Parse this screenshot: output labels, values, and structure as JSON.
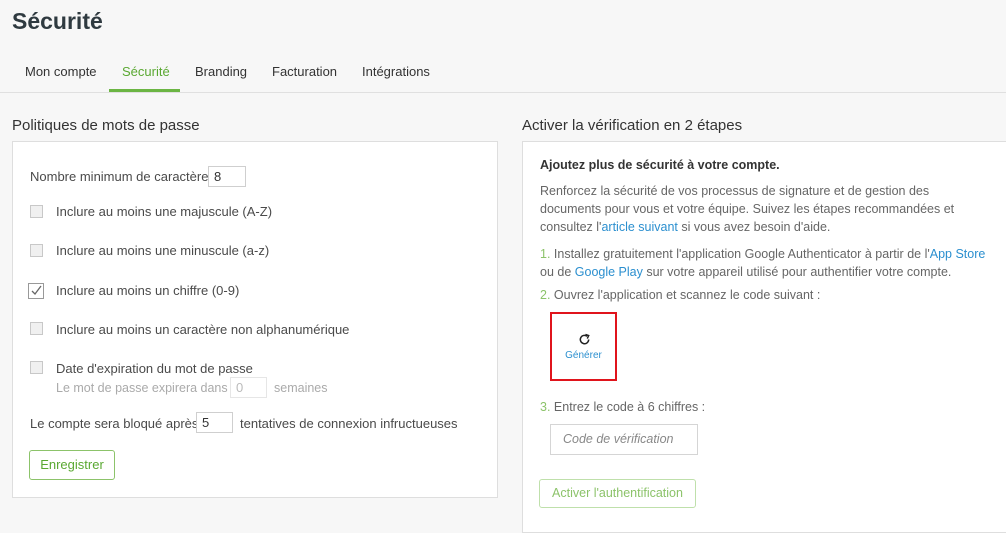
{
  "page": {
    "title": "Sécurité"
  },
  "tabs": [
    {
      "label": "Mon compte"
    },
    {
      "label": "Sécurité"
    },
    {
      "label": "Branding"
    },
    {
      "label": "Facturation"
    },
    {
      "label": "Intégrations"
    }
  ],
  "active_tab": 1,
  "password_policy": {
    "title": "Politiques de mots de passe",
    "min_chars_label": "Nombre minimum de caractères",
    "min_chars_value": "8",
    "options": [
      {
        "label": "Inclure au moins une majuscule (A-Z)",
        "checked": false
      },
      {
        "label": "Inclure au moins une minuscule (a-z)",
        "checked": false
      },
      {
        "label": "Inclure au moins un chiffre (0-9)",
        "checked": true
      },
      {
        "label": "Inclure au moins un caractère non alphanumérique",
        "checked": false
      },
      {
        "label": "Date d'expiration du mot de passe",
        "checked": false
      }
    ],
    "expiry_label": "Le mot de passe expirera dans :",
    "expiry_value": "0",
    "expiry_unit": "semaines",
    "lockout_label": "Le compte sera bloqué après :",
    "lockout_value": "5",
    "lockout_suffix": "tentatives de connexion infructueuses",
    "save_button": "Enregistrer"
  },
  "two_factor": {
    "title": "Activer la vérification en 2 étapes",
    "heading": "Ajoutez plus de sécurité à votre compte.",
    "intro_text": "Renforcez la sécurité de vos processus de signature et de gestion des documents pour vous et votre équipe. Suivez les étapes recommandées et consultez l'",
    "intro_link": "article suivant",
    "intro_tail": " si vous avez besoin d'aide.",
    "step1_num": "1.",
    "step1_text": " Installez gratuitement l'application Google Authenticator à partir de l'",
    "step1_link1": "App Store",
    "step1_mid": " ou de ",
    "step1_link2": "Google Play",
    "step1_tail": " sur votre appareil utilisé pour authentifier votre compte.",
    "step2_num": "2.",
    "step2_text": " Ouvrez l'application et scannez le code suivant :",
    "generate_label": "Générer",
    "step3_num": "3.",
    "step3_text": " Entrez le code à 6 chiffres :",
    "code_placeholder": "Code de vérification",
    "activate_button": "Activer l'authentification"
  },
  "colors": {
    "accent": "#6bb543",
    "link": "#2b8fcf",
    "highlight": "#e0141c"
  }
}
